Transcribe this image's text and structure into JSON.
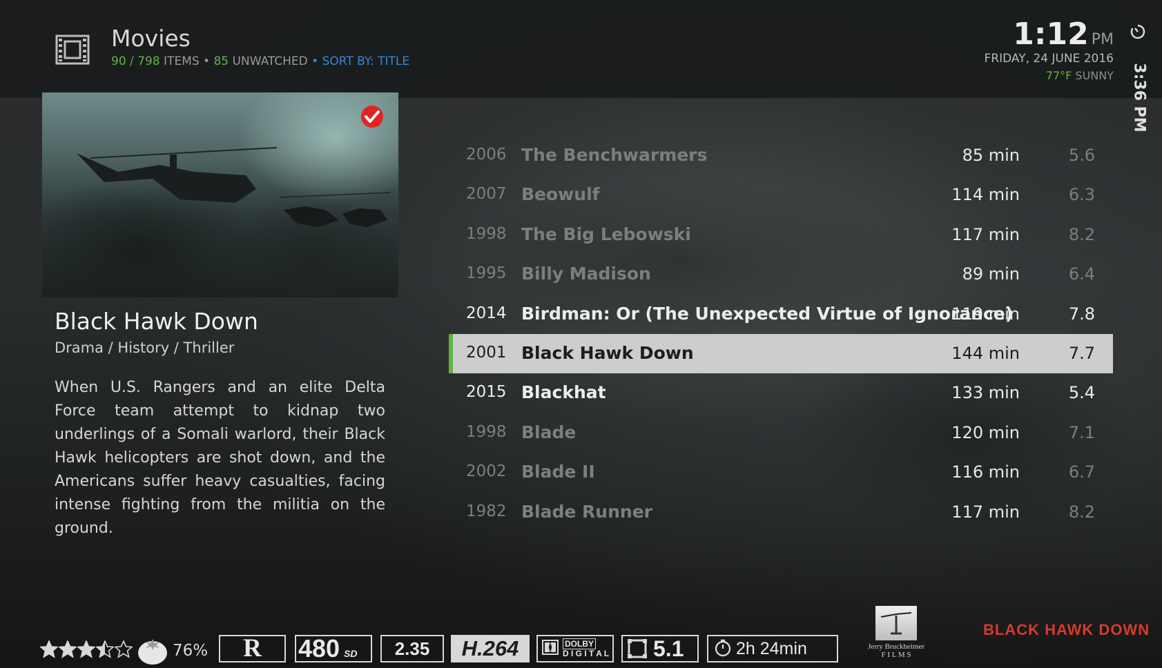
{
  "header": {
    "title": "Movies",
    "items_shown": "90",
    "items_sep": " / ",
    "items_total": "798",
    "items_label": " ITEMS • ",
    "unwatched_count": "85",
    "unwatched_label": "  UNWATCHED",
    "sort_label": "  • SORT BY: TITLE",
    "icon": "film-strip-icon"
  },
  "clock": {
    "time": "1:12",
    "ampm": "PM",
    "date": "FRIDAY, 24 JUNE 2016",
    "temperature": "77°F",
    "condition": "SUNNY",
    "end_time": "3:36 PM",
    "end_icon": "timer-icon"
  },
  "selected_movie": {
    "title": "Black Hawk Down",
    "genre": "Drama / History / Thriller",
    "plot": "When U.S. Rangers and an elite Delta Force team attempt to kidnap two underlings of a Somali warlord, their Black Hawk helicopters are shot down, and the Americans suffer heavy casualties, facing intense fighting from the militia on the ground.",
    "watched": true
  },
  "movies": [
    {
      "year": "2006",
      "title": "The Benchwarmers",
      "duration": "85 min",
      "rating": "5.6",
      "state": "dim"
    },
    {
      "year": "2007",
      "title": "Beowulf",
      "duration": "114 min",
      "rating": "6.3",
      "state": "dim"
    },
    {
      "year": "1998",
      "title": "The Big Lebowski",
      "duration": "117 min",
      "rating": "8.2",
      "state": "dim"
    },
    {
      "year": "1995",
      "title": "Billy Madison",
      "duration": "89 min",
      "rating": "6.4",
      "state": "dim"
    },
    {
      "year": "2014",
      "title": "Birdman: Or (The Unexpected Virtue of Ignorance)",
      "duration": "119 min",
      "rating": "7.8",
      "state": "bright"
    },
    {
      "year": "2001",
      "title": "Black Hawk Down",
      "duration": "144 min",
      "rating": "7.7",
      "state": "selected"
    },
    {
      "year": "2015",
      "title": "Blackhat",
      "duration": "133 min",
      "rating": "5.4",
      "state": "bright"
    },
    {
      "year": "1998",
      "title": "Blade",
      "duration": "120 min",
      "rating": "7.1",
      "state": "dim"
    },
    {
      "year": "2002",
      "title": "Blade II",
      "duration": "116 min",
      "rating": "6.7",
      "state": "dim"
    },
    {
      "year": "1982",
      "title": "Blade Runner",
      "duration": "117 min",
      "rating": "8.2",
      "state": "dim"
    }
  ],
  "footer": {
    "star_rating": 3.5,
    "star_max": 5,
    "tomato_score": "76%",
    "mpaa": "R",
    "resolution": "480",
    "resolution_suffix": "SD",
    "aspect": "2.35",
    "codec": "H.264",
    "audio_line1": "DOLBY",
    "audio_line2": "D I G I T A L",
    "channels": "5.1",
    "runtime": "2h 24min",
    "studio_line1": "Jerry Bruckheimer",
    "studio_line2": "F I L M S",
    "clearlogo": "BLACK HAWK DOWN"
  },
  "colors": {
    "accent_green": "#5fb640",
    "sort_blue": "#3a86d6",
    "clearlogo_red": "#d83a2b",
    "selected_bg": "#cdcdcd"
  }
}
